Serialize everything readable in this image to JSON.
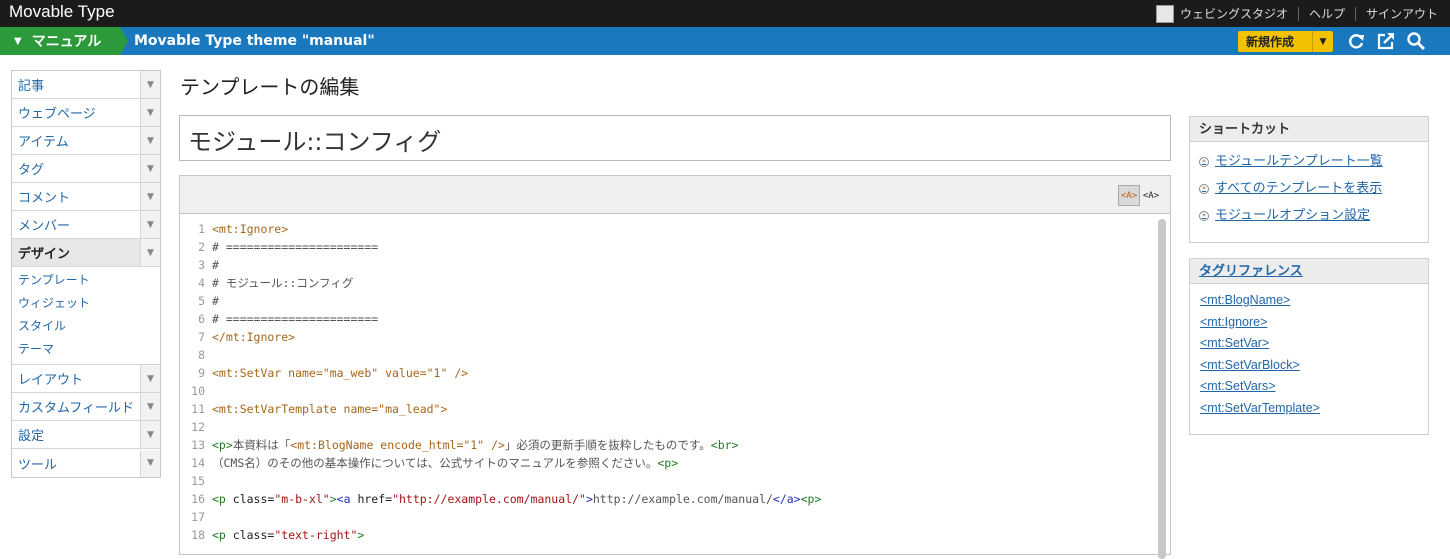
{
  "app": {
    "name": "Movable Type"
  },
  "user": {
    "name": "ウェビングスタジオ",
    "help": "ヘルプ",
    "signout": "サインアウト"
  },
  "site": {
    "name": "マニュアル",
    "blog_title": "Movable Type theme \"manual\""
  },
  "toolbar": {
    "new_label": "新規作成",
    "icons": [
      "refresh-icon",
      "external-link-icon",
      "search-icon"
    ]
  },
  "nav": {
    "items": [
      "記事",
      "ウェブページ",
      "アイテム",
      "タグ",
      "コメント",
      "メンバー"
    ],
    "active": "デザイン",
    "subitems": [
      "テンプレート",
      "ウィジェット",
      "スタイル",
      "テーマ"
    ],
    "items_after": [
      "レイアウト",
      "カスタムフィールド",
      "設定",
      "ツール"
    ]
  },
  "page": {
    "title": "テンプレートの編集",
    "template_name": "モジュール::コンフィグ"
  },
  "editor": {
    "syntax_on": "<A>",
    "syntax_off": "<A>",
    "lines": [
      {
        "n": "1",
        "parts": [
          [
            "t-mt",
            "<mt:Ignore>"
          ]
        ]
      },
      {
        "n": "2",
        "parts": [
          [
            "t-gray",
            "# ======================"
          ]
        ]
      },
      {
        "n": "3",
        "parts": [
          [
            "t-gray",
            "#"
          ]
        ]
      },
      {
        "n": "4",
        "parts": [
          [
            "t-gray",
            "# モジュール::コンフィグ"
          ]
        ]
      },
      {
        "n": "5",
        "parts": [
          [
            "t-gray",
            "#"
          ]
        ]
      },
      {
        "n": "6",
        "parts": [
          [
            "t-gray",
            "# ======================"
          ]
        ]
      },
      {
        "n": "7",
        "parts": [
          [
            "t-mt",
            "</mt:Ignore>"
          ]
        ]
      },
      {
        "n": "8",
        "parts": []
      },
      {
        "n": "9",
        "parts": [
          [
            "t-mt",
            "<mt:SetVar name=\"ma_web\" value=\"1\" />"
          ]
        ]
      },
      {
        "n": "10",
        "parts": []
      },
      {
        "n": "11",
        "parts": [
          [
            "t-mt",
            "<mt:SetVarTemplate name=\"ma_lead\">"
          ]
        ]
      },
      {
        "n": "12",
        "parts": []
      },
      {
        "n": "13",
        "parts": [
          [
            "t-html",
            "<p>"
          ],
          [
            "t-gray",
            "本資料は「"
          ],
          [
            "t-mt",
            "<mt:BlogName encode_html=\"1\" />"
          ],
          [
            "t-gray",
            "」必須の更新手順を抜粋したものです。"
          ],
          [
            "t-html",
            "<br>"
          ]
        ]
      },
      {
        "n": "14",
        "parts": [
          [
            "t-gray",
            "（CMS名）のその他の基本操作については、公式サイトのマニュアルを参照ください。"
          ],
          [
            "t-html",
            "<p>"
          ]
        ]
      },
      {
        "n": "15",
        "parts": []
      },
      {
        "n": "16",
        "parts": [
          [
            "t-html",
            "<p "
          ],
          [
            "t-attr",
            "class="
          ],
          [
            "t-str",
            "\"m-b-xl\""
          ],
          [
            "t-html",
            ">"
          ],
          [
            "t-hatag",
            "<a "
          ],
          [
            "t-attr",
            "href="
          ],
          [
            "t-str",
            "\"http://example.com/manual/\""
          ],
          [
            "t-hatag",
            ">"
          ],
          [
            "t-gray",
            "http://example.com/manual/"
          ],
          [
            "t-hatag",
            "</a>"
          ],
          [
            "t-html",
            "<p>"
          ]
        ]
      },
      {
        "n": "17",
        "parts": []
      },
      {
        "n": "18",
        "parts": [
          [
            "t-html",
            "<p "
          ],
          [
            "t-attr",
            "class="
          ],
          [
            "t-str",
            "\"text-right\""
          ],
          [
            "t-html",
            ">"
          ]
        ]
      }
    ]
  },
  "shortcuts": {
    "title": "ショートカット",
    "items": [
      "モジュールテンプレート一覧",
      "すべてのテンプレートを表示",
      "モジュールオプション設定"
    ]
  },
  "tag_reference": {
    "title": "タグリファレンス",
    "items": [
      "<mt:BlogName>",
      "<mt:Ignore>",
      "<mt:SetVar>",
      "<mt:SetVarBlock>",
      "<mt:SetVars>",
      "<mt:SetVarTemplate>"
    ]
  }
}
